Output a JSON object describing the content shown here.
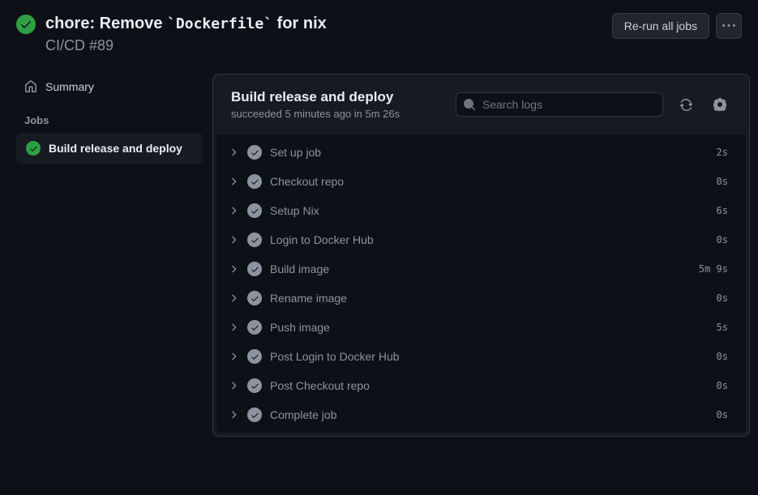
{
  "header": {
    "title_prefix": "chore: Remove ",
    "title_code": "`Dockerfile`",
    "title_suffix": " for nix",
    "subtitle": "CI/CD #89",
    "rerun_label": "Re-run all jobs"
  },
  "sidebar": {
    "summary_label": "Summary",
    "jobs_heading": "Jobs",
    "job_label": "Build release and deploy"
  },
  "content": {
    "title": "Build release and deploy",
    "status_text": "succeeded 5 minutes ago in 5m 26s",
    "search_placeholder": "Search logs"
  },
  "steps": [
    {
      "name": "Set up job",
      "time": "2s"
    },
    {
      "name": "Checkout repo",
      "time": "0s"
    },
    {
      "name": "Setup Nix",
      "time": "6s"
    },
    {
      "name": "Login to Docker Hub",
      "time": "0s"
    },
    {
      "name": "Build image",
      "time": "5m 9s"
    },
    {
      "name": "Rename image",
      "time": "0s"
    },
    {
      "name": "Push image",
      "time": "5s"
    },
    {
      "name": "Post Login to Docker Hub",
      "time": "0s"
    },
    {
      "name": "Post Checkout repo",
      "time": "0s"
    },
    {
      "name": "Complete job",
      "time": "0s"
    }
  ]
}
